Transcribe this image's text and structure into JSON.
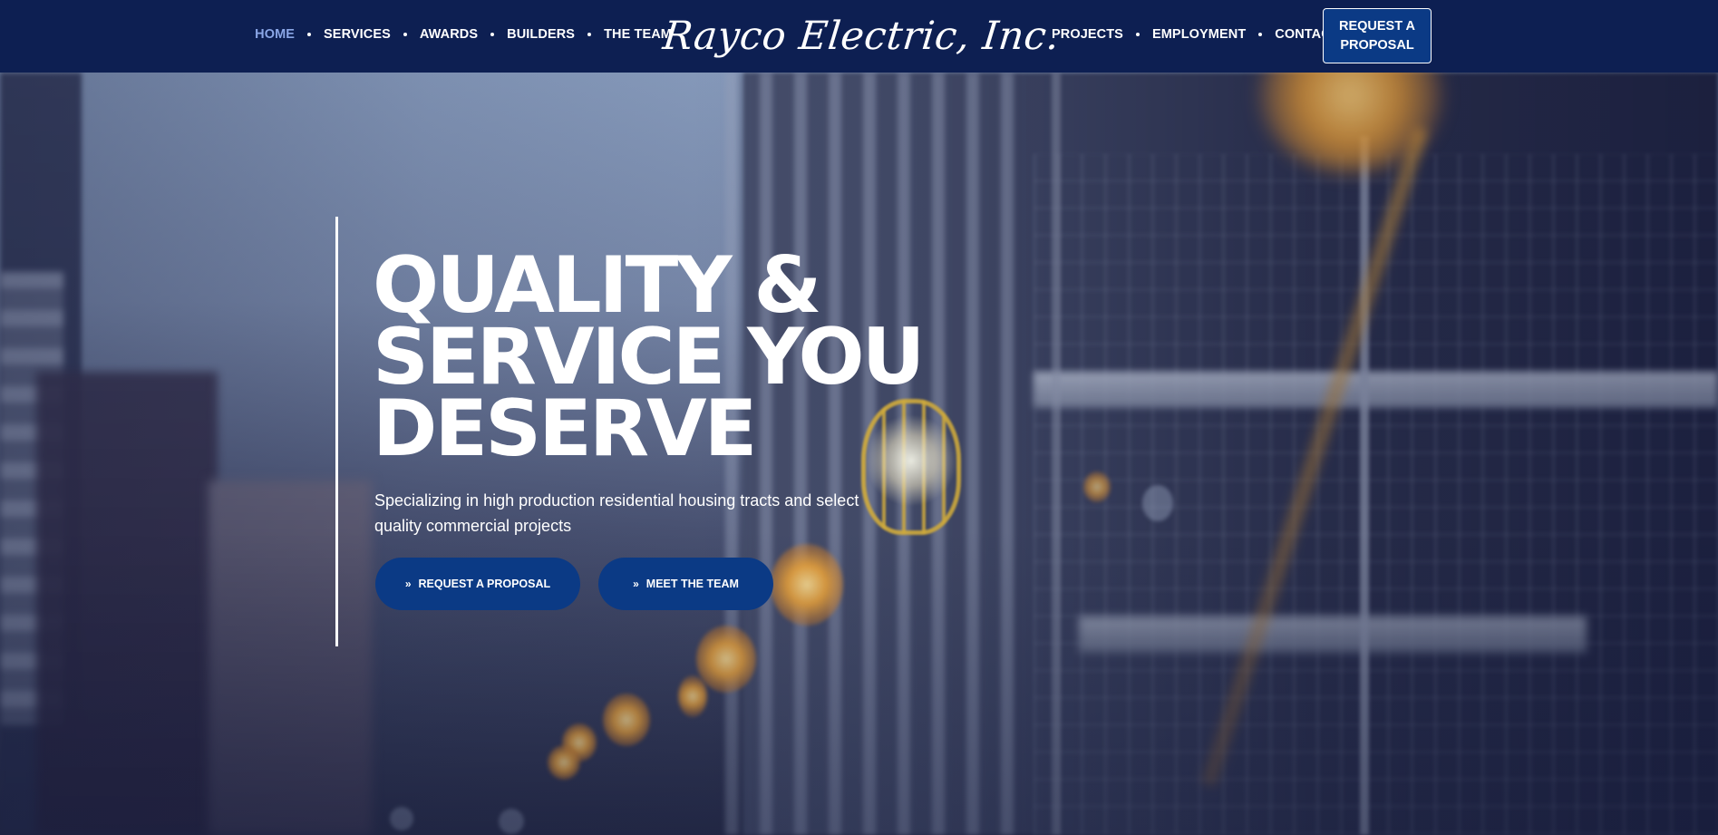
{
  "header": {
    "logo_text": "Rayco Electric, Inc.",
    "nav_left": [
      {
        "label": "HOME",
        "active": true
      },
      {
        "label": "SERVICES",
        "active": false
      },
      {
        "label": "AWARDS",
        "active": false
      },
      {
        "label": "BUILDERS",
        "active": false
      },
      {
        "label": "THE TEAM",
        "active": false
      }
    ],
    "nav_right": [
      {
        "label": "PROJECTS",
        "active": false
      },
      {
        "label": "EMPLOYMENT",
        "active": false
      },
      {
        "label": "CONTACT",
        "active": false
      }
    ],
    "cta_label": "REQUEST A PROPOSAL"
  },
  "hero": {
    "title_lines": [
      "QUALITY &",
      "SERVICE YOU",
      "DESERVE"
    ],
    "subtitle": "Specializing in high production residential housing tracts and select quality commercial projects",
    "buttons": [
      {
        "label": "REQUEST A PROPOSAL",
        "icon": "double-chevron-right-icon"
      },
      {
        "label": "MEET THE TEAM",
        "icon": "double-chevron-right-icon"
      }
    ]
  },
  "colors": {
    "header_bg": "#0d1f52",
    "accent_button": "#0b3a85",
    "active_nav": "#8aa6e6",
    "text": "#ffffff"
  }
}
